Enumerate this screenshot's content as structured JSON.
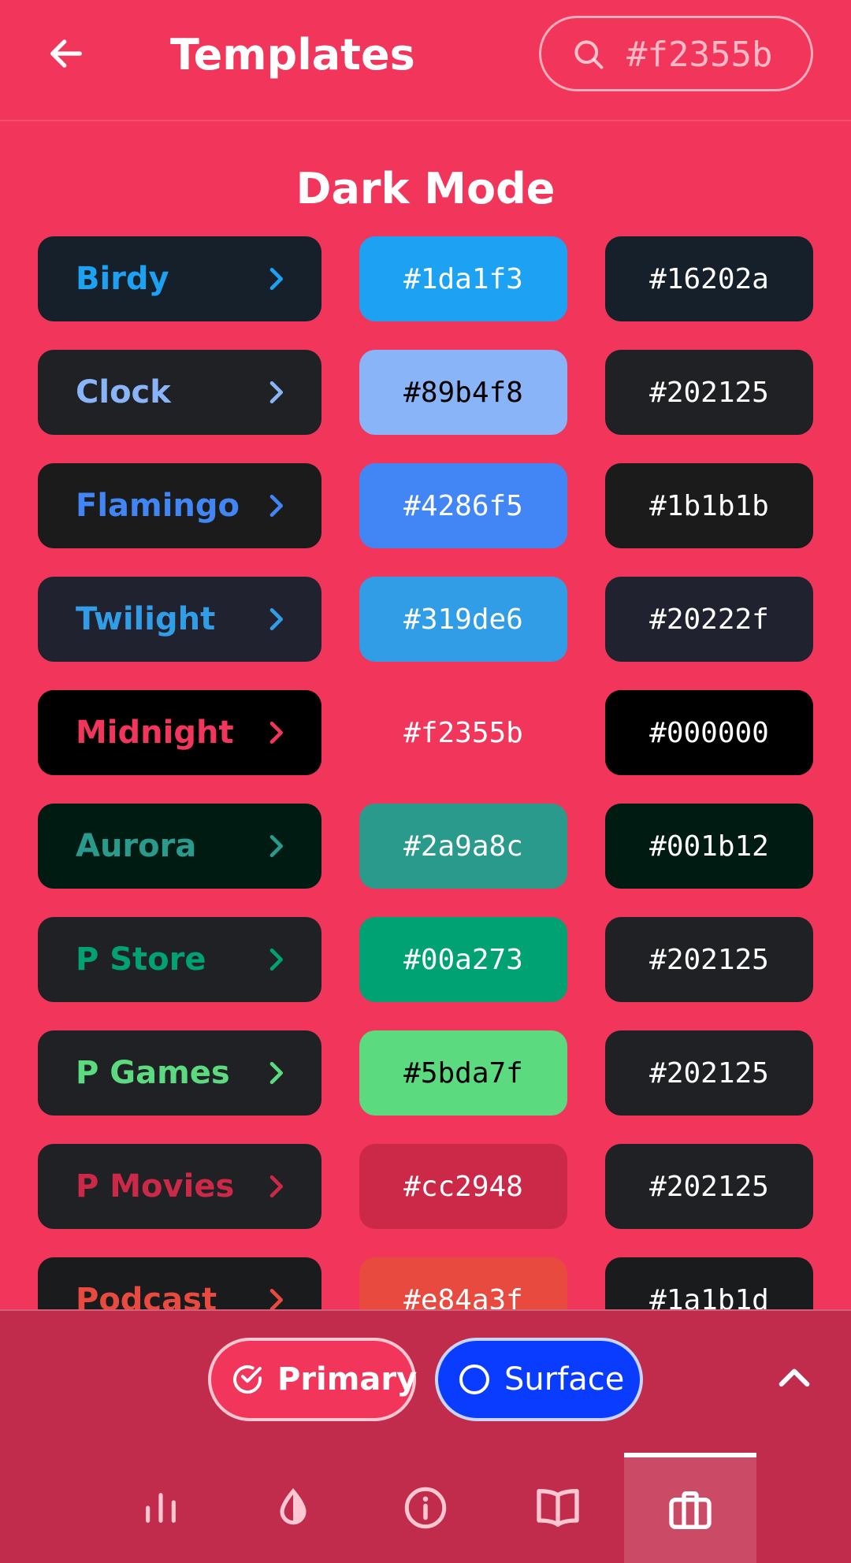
{
  "header": {
    "title": "Templates",
    "search_value": "#f2355b"
  },
  "section_title": "Dark Mode",
  "templates": [
    {
      "name": "Birdy",
      "name_color": "#1da1f3",
      "bg": "#16202a",
      "primary": "#1da1f3",
      "primary_text": "#ffffff",
      "surface": "#16202a"
    },
    {
      "name": "Clock",
      "name_color": "#89b4f8",
      "bg": "#202125",
      "primary": "#89b4f8",
      "primary_text": "#000000",
      "surface": "#202125"
    },
    {
      "name": "Flamingo",
      "name_color": "#4286f5",
      "bg": "#1b1b1b",
      "primary": "#4286f5",
      "primary_text": "#ffffff",
      "surface": "#1b1b1b"
    },
    {
      "name": "Twilight",
      "name_color": "#319de6",
      "bg": "#20222f",
      "primary": "#319de6",
      "primary_text": "#ffffff",
      "surface": "#20222f"
    },
    {
      "name": "Midnight",
      "name_color": "#f2355b",
      "bg": "#000000",
      "primary": "#f2355b",
      "primary_text": "#ffffff",
      "surface": "#000000"
    },
    {
      "name": "Aurora",
      "name_color": "#2a9a8c",
      "bg": "#001b12",
      "primary": "#2a9a8c",
      "primary_text": "#ffffff",
      "surface": "#001b12"
    },
    {
      "name": "P Store",
      "name_color": "#00a273",
      "bg": "#202125",
      "primary": "#00a273",
      "primary_text": "#ffffff",
      "surface": "#202125"
    },
    {
      "name": "P Games",
      "name_color": "#5bda7f",
      "bg": "#202125",
      "primary": "#5bda7f",
      "primary_text": "#000000",
      "surface": "#202125"
    },
    {
      "name": "P Movies",
      "name_color": "#cc2948",
      "bg": "#202125",
      "primary": "#cc2948",
      "primary_text": "#ffffff",
      "surface": "#202125"
    },
    {
      "name": "Podcast",
      "name_color": "#e84a3f",
      "bg": "#1a1b1d",
      "primary": "#e84a3f",
      "primary_text": "#ffffff",
      "surface": "#1a1b1d"
    }
  ],
  "toggles": {
    "primary_label": "Primary",
    "surface_label": "Surface"
  },
  "nav": {
    "items": [
      {
        "icon": "chart-icon"
      },
      {
        "icon": "water-drop-icon"
      },
      {
        "icon": "info-icon"
      },
      {
        "icon": "book-icon"
      },
      {
        "icon": "briefcase-icon",
        "active": true
      }
    ]
  }
}
